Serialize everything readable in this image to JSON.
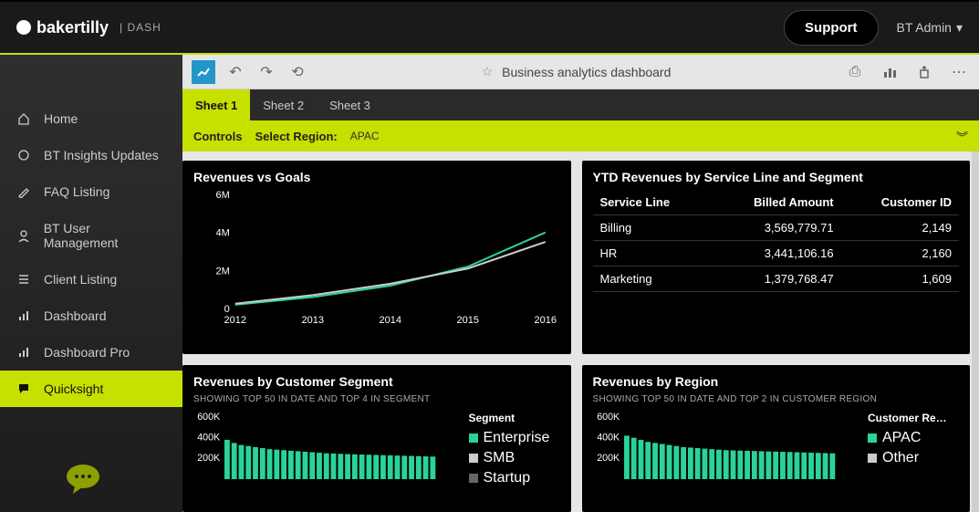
{
  "header": {
    "brand": "bakertilly",
    "brand_suffix": "| DASH",
    "support_label": "Support",
    "user_label": "BT Admin"
  },
  "sidebar": {
    "items": [
      {
        "label": "Home",
        "icon": "home-icon"
      },
      {
        "label": "BT Insights Updates",
        "icon": "insights-icon"
      },
      {
        "label": "FAQ Listing",
        "icon": "edit-icon"
      },
      {
        "label": "BT User Management",
        "icon": "user-icon"
      },
      {
        "label": "Client Listing",
        "icon": "list-icon"
      },
      {
        "label": "Dashboard",
        "icon": "chart-icon"
      },
      {
        "label": "Dashboard Pro",
        "icon": "chart-icon"
      },
      {
        "label": "Quicksight",
        "icon": "chat-icon"
      }
    ],
    "active_index": 7
  },
  "toolbar": {
    "title": "Business analytics dashboard"
  },
  "tabs": {
    "items": [
      {
        "label": "Sheet 1"
      },
      {
        "label": "Sheet 2"
      },
      {
        "label": "Sheet 3"
      }
    ],
    "active_index": 0
  },
  "controls": {
    "label": "Controls",
    "select_region_label": "Select Region:",
    "region_value": "APAC"
  },
  "panels": {
    "rev_goals": {
      "title": "Revenues vs Goals"
    },
    "ytd": {
      "title": "YTD Revenues by Service Line and Segment",
      "columns": [
        "Service Line",
        "Billed Amount",
        "Customer ID"
      ],
      "rows": [
        {
          "service": "Billing",
          "billed": "3,569,779.71",
          "cust": "2,149"
        },
        {
          "service": "HR",
          "billed": "3,441,106.16",
          "cust": "2,160"
        },
        {
          "service": "Marketing",
          "billed": "1,379,768.47",
          "cust": "1,609"
        }
      ]
    },
    "rev_seg": {
      "title": "Revenues by Customer Segment",
      "subtitle": "SHOWING TOP 50 IN DATE AND TOP 4 IN SEGMENT",
      "legend_title": "Segment",
      "legend": [
        {
          "label": "Enterprise",
          "color": "#29d39a"
        },
        {
          "label": "SMB",
          "color": "#cccccc"
        },
        {
          "label": "Startup",
          "color": "#666666"
        }
      ]
    },
    "rev_region": {
      "title": "Revenues by Region",
      "subtitle": "SHOWING TOP 50 IN DATE AND TOP 2 IN CUSTOMER REGION",
      "legend_title": "Customer Re…",
      "legend": [
        {
          "label": "APAC",
          "color": "#29d39a"
        },
        {
          "label": "Other",
          "color": "#cccccc"
        }
      ]
    }
  },
  "chart_data": [
    {
      "id": "rev_goals",
      "type": "line",
      "x": [
        2012,
        2013,
        2014,
        2015,
        2016
      ],
      "series": [
        {
          "name": "Revenue",
          "values": [
            200000,
            600000,
            1200000,
            2200000,
            4000000
          ],
          "color": "#29d39a"
        },
        {
          "name": "Goal",
          "values": [
            250000,
            700000,
            1300000,
            2100000,
            3500000
          ],
          "color": "#cccccc"
        }
      ],
      "ylim": [
        0,
        6000000
      ],
      "yticks": [
        0,
        2000000,
        4000000,
        6000000
      ],
      "ytick_labels": [
        "0",
        "2M",
        "4M",
        "6M"
      ],
      "xlabel": "",
      "ylabel": ""
    },
    {
      "id": "rev_seg",
      "type": "bar",
      "yticks": [
        200000,
        400000,
        600000
      ],
      "ytick_labels": [
        "200K",
        "400K",
        "600K"
      ],
      "values": [
        380000,
        350000,
        330000,
        320000,
        310000,
        300000,
        290000,
        285000,
        280000,
        275000,
        270000,
        265000,
        260000,
        255000,
        250000,
        248000,
        245000,
        242000,
        240000,
        238000,
        236000,
        234000,
        232000,
        230000,
        228000,
        226000,
        224000,
        222000,
        220000,
        218000
      ]
    },
    {
      "id": "rev_region",
      "type": "bar",
      "yticks": [
        200000,
        400000,
        600000
      ],
      "ytick_labels": [
        "200K",
        "400K",
        "600K"
      ],
      "values": [
        420000,
        400000,
        380000,
        360000,
        350000,
        340000,
        330000,
        320000,
        310000,
        305000,
        300000,
        295000,
        290000,
        285000,
        280000,
        278000,
        276000,
        274000,
        272000,
        270000,
        268000,
        266000,
        264000,
        262000,
        260000,
        258000,
        256000,
        254000,
        252000,
        250000
      ]
    }
  ]
}
